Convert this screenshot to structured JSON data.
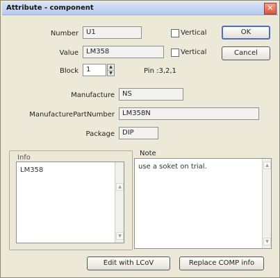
{
  "window": {
    "title": "Attribute - component",
    "close_glyph": "✕"
  },
  "number": {
    "label": "Number",
    "value": "U1",
    "vertical_label": "Vertical",
    "vertical_checked": false
  },
  "value": {
    "label": "Value",
    "value": "LM358",
    "vertical_label": "Vertical",
    "vertical_checked": false
  },
  "block": {
    "label": "Block",
    "value": "1",
    "pin_text": "Pin :3,2,1"
  },
  "manufacture": {
    "label": "Manufacture",
    "value": "NS"
  },
  "part_number": {
    "label": "ManufacturePartNumber",
    "value": "LM358N"
  },
  "package": {
    "label": "Package",
    "value": "DIP"
  },
  "info": {
    "label": "Info",
    "text": "LM358"
  },
  "note": {
    "label": "Note",
    "text": "use a soket on trial."
  },
  "buttons": {
    "ok": "OK",
    "cancel": "Cancel",
    "edit_with_lcov": "Edit with LCoV",
    "replace_comp_info": "Replace COMP info"
  },
  "icons": {
    "close": "close-icon",
    "spin_up": "spin-up-icon",
    "spin_down": "spin-down-icon",
    "scroll_up": "scroll-up-icon",
    "scroll_down": "scroll-down-icon"
  }
}
